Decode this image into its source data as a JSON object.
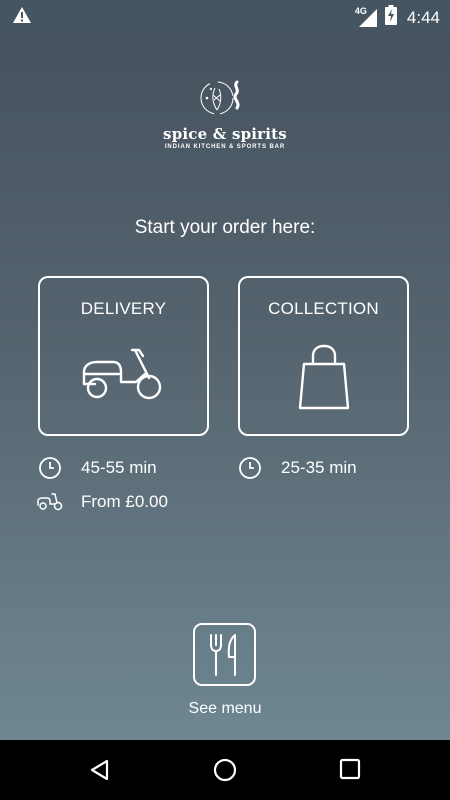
{
  "status_bar": {
    "network": "4G",
    "time": "4:44"
  },
  "logo": {
    "brand": "spice & spirits",
    "tagline": "INDIAN KITCHEN & SPORTS BAR"
  },
  "headline": "Start your order here:",
  "options": {
    "delivery": {
      "label": "DELIVERY",
      "time": "45-55 min",
      "fee": "From £0.00"
    },
    "collection": {
      "label": "COLLECTION",
      "time": "25-35 min"
    }
  },
  "menu": {
    "label": "See menu"
  },
  "icons": {
    "warning": "warning-icon",
    "signal": "signal-icon",
    "battery": "battery-icon",
    "scooter": "scooter-icon",
    "bag": "shopping-bag-icon",
    "clock": "clock-icon",
    "cutlery": "cutlery-icon",
    "back": "back-icon",
    "home": "home-icon",
    "recents": "recents-icon"
  },
  "colors": {
    "status_bar": "#455561",
    "gradient_top": "#46535f",
    "gradient_bottom": "#6e8791",
    "nav_bar": "#000000"
  }
}
